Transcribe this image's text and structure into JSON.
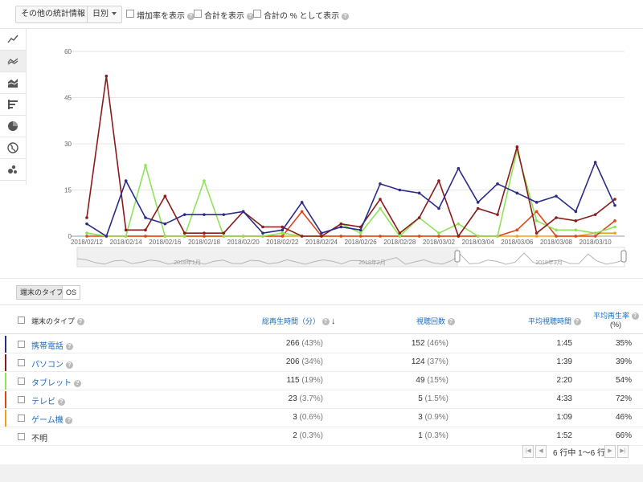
{
  "toolbar": {
    "stats_dropdown": "その他の統計情報",
    "period_dropdown": "日別",
    "show_growth": "増加率を表示",
    "show_total": "合計を表示",
    "show_total_pct": "合計の % として表示"
  },
  "chart_data": {
    "type": "line",
    "ylim": [
      0,
      60
    ],
    "yticks": [
      "0",
      "15",
      "30",
      "45",
      "60"
    ],
    "xticks": [
      "2018/02/12",
      "2018/02/14",
      "2018/02/16",
      "2018/02/18",
      "2018/02/20",
      "2018/02/22",
      "2018/02/24",
      "2018/02/26",
      "2018/02/28",
      "2018/03/02",
      "2018/03/04",
      "2018/03/06",
      "2018/03/08",
      "2018/03/10"
    ],
    "series": [
      {
        "key": "mobile",
        "color": "#2b2b8a",
        "values": [
          4,
          0,
          18,
          6,
          4,
          7,
          7,
          7,
          8,
          1,
          2,
          11,
          1,
          3,
          2,
          17,
          15,
          14,
          9,
          22,
          11,
          17,
          14,
          11,
          13,
          8,
          24,
          10
        ]
      },
      {
        "key": "pc",
        "color": "#8b1a1a",
        "values": [
          6,
          52,
          2,
          2,
          13,
          1,
          1,
          1,
          8,
          3,
          3,
          0,
          0,
          4,
          3,
          12,
          1,
          6,
          18,
          0,
          9,
          7,
          29,
          1,
          6,
          5,
          7,
          12
        ]
      },
      {
        "key": "tablet",
        "color": "#8fe35a",
        "values": [
          1,
          0,
          0,
          23,
          0,
          0,
          18,
          0,
          0,
          0,
          1,
          0,
          0,
          4,
          1,
          9,
          0,
          6,
          1,
          4,
          0,
          0,
          28,
          5,
          2,
          2,
          1,
          3
        ]
      },
      {
        "key": "tv",
        "color": "#d9471c",
        "values": [
          0,
          0,
          0,
          0,
          0,
          0,
          0,
          0,
          0,
          0,
          0,
          8,
          0,
          0,
          0,
          0,
          0,
          0,
          0,
          0,
          0,
          0,
          2,
          8,
          0,
          0,
          0,
          5
        ]
      },
      {
        "key": "game",
        "color": "#f0a020",
        "values": [
          1,
          0,
          0,
          0,
          0,
          0,
          0,
          0,
          0,
          0,
          0,
          0,
          0,
          0,
          0,
          0,
          0,
          0,
          0,
          0,
          0,
          0,
          0,
          0,
          0,
          0,
          1,
          1
        ]
      }
    ],
    "navigator_labels": [
      "2018年1月",
      "2018年2月",
      "2018年3月"
    ]
  },
  "tabs": {
    "device": "端末のタイプ",
    "os": "OS"
  },
  "table": {
    "headers": {
      "type": "端末のタイプ",
      "watch_time": "総再生時間（分）",
      "views": "視聴回数",
      "avg_duration": "平均視聴時間",
      "avg_pct": "平均再生率",
      "avg_pct_unit": "(%)"
    },
    "rows": [
      {
        "name": "携帯電話",
        "color": "#2b2b8a",
        "link": true,
        "watch": "266",
        "watch_pct": "(43%)",
        "views": "152",
        "views_pct": "(46%)",
        "dur": "1:45",
        "pct": "35%"
      },
      {
        "name": "パソコン",
        "color": "#8b1a1a",
        "link": true,
        "watch": "206",
        "watch_pct": "(34%)",
        "views": "124",
        "views_pct": "(37%)",
        "dur": "1:39",
        "pct": "39%"
      },
      {
        "name": "タブレット",
        "color": "#8fe35a",
        "link": true,
        "watch": "115",
        "watch_pct": "(19%)",
        "views": "49",
        "views_pct": "(15%)",
        "dur": "2:20",
        "pct": "54%"
      },
      {
        "name": "テレビ",
        "color": "#d9471c",
        "link": true,
        "watch": "23",
        "watch_pct": "(3.7%)",
        "views": "5",
        "views_pct": "(1.5%)",
        "dur": "4:33",
        "pct": "72%"
      },
      {
        "name": "ゲーム機",
        "color": "#f0a020",
        "link": true,
        "watch": "3",
        "watch_pct": "(0.6%)",
        "views": "3",
        "views_pct": "(0.9%)",
        "dur": "1:09",
        "pct": "46%"
      },
      {
        "name": "不明",
        "color": "",
        "link": false,
        "watch": "2",
        "watch_pct": "(0.3%)",
        "views": "1",
        "views_pct": "(0.3%)",
        "dur": "1:52",
        "pct": "66%"
      }
    ]
  },
  "pager": {
    "text": "6 行中 1～6 行"
  }
}
